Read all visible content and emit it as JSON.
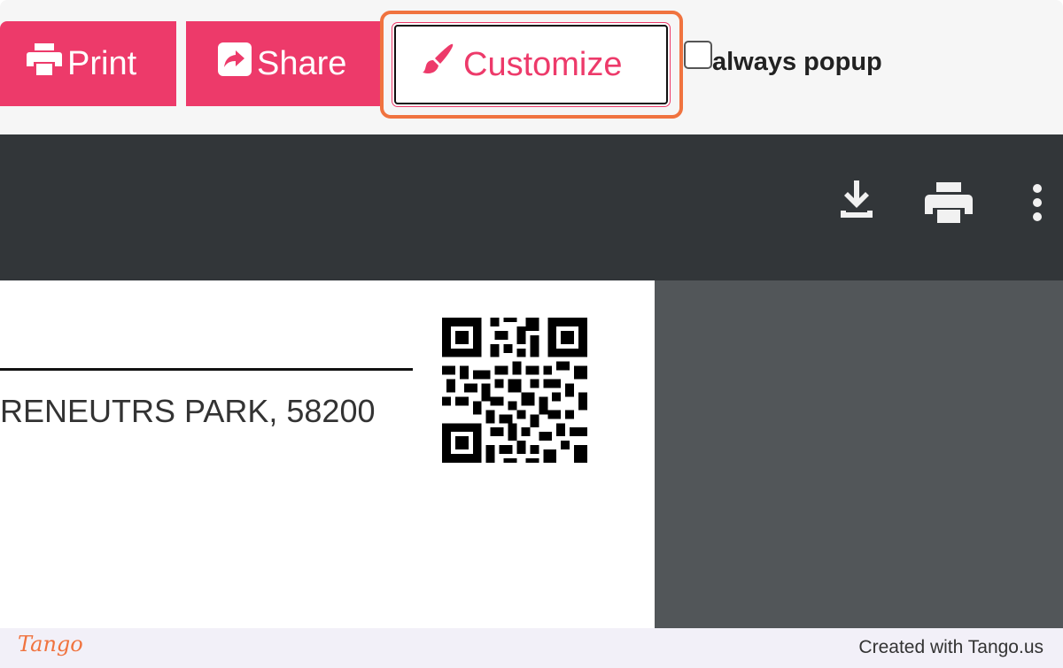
{
  "toolbar": {
    "print_label": "Print",
    "share_label": "Share",
    "customize_label": "Customize",
    "always_popup_label": "always popup",
    "always_popup_checked": false,
    "brand_color": "#ed3a6a",
    "highlight_color": "#f0733f",
    "icons": {
      "print": "printer-icon",
      "share": "share-icon",
      "customize": "paintbrush-icon"
    }
  },
  "viewer": {
    "background_color": "#323639",
    "icons": [
      "download-icon",
      "printer-icon",
      "more-vert-icon"
    ]
  },
  "document": {
    "address_fragment": "RENEUTRS PARK, 58200"
  },
  "footer": {
    "logo": "Tango",
    "created_with": "Created with Tango.us"
  }
}
